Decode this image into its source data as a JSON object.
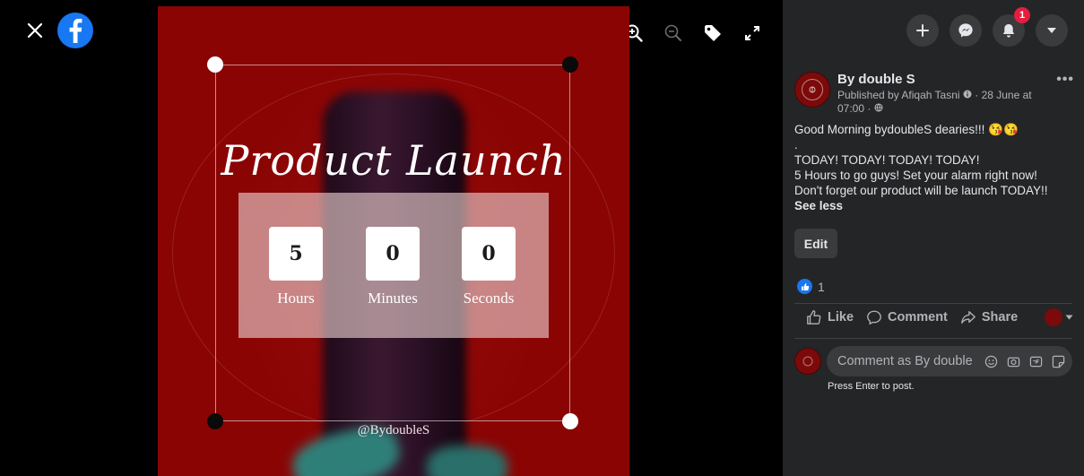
{
  "viewer": {
    "icons": [
      "close-icon",
      "facebook-logo",
      "zoom-in-icon",
      "zoom-out-icon",
      "tag-icon",
      "fullscreen-icon"
    ]
  },
  "photo": {
    "title": "Product Launch",
    "countdown": [
      {
        "value": "5",
        "label": "Hours"
      },
      {
        "value": "0",
        "label": "Minutes"
      },
      {
        "value": "0",
        "label": "Seconds"
      }
    ],
    "handle": "@BydoubleS",
    "colors": {
      "background": "#8a0404",
      "panel": "#eed2d2"
    }
  },
  "nav": {
    "icons": [
      "plus-icon",
      "messenger-icon",
      "bell-icon",
      "caret-down-icon"
    ],
    "notifications_badge": "1"
  },
  "post": {
    "page_name": "By double S",
    "byline_line1": "Published by Afiqah Tasni",
    "byline_date": "· 28 June at",
    "byline_line2": "07:00 ·",
    "body_lines": [
      "Good Morning bydoubleS dearies!!!",
      ".",
      "TODAY! TODAY! TODAY! TODAY!",
      "5 Hours to go guys! Set your alarm right now!",
      "Don't forget our product will be launch TODAY!!"
    ],
    "emoji": "😘😘",
    "see_less": "See less",
    "edit_label": "Edit",
    "reaction_count": "1",
    "actions": {
      "like": "Like",
      "comment": "Comment",
      "share": "Share"
    },
    "comment_placeholder": "Comment as By double S",
    "press_enter": "Press Enter to post."
  },
  "colors": {
    "panel_bg": "#242526",
    "button_bg": "#3a3b3c",
    "accent": "#1877f2",
    "badge": "#e41e3f"
  }
}
